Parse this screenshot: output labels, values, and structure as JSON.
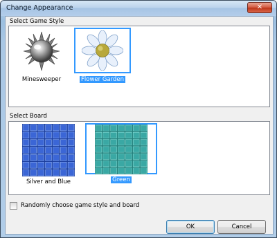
{
  "window": {
    "title": "Change Appearance",
    "close_symbol": "✕"
  },
  "game_style": {
    "label": "Select Game Style",
    "items": [
      {
        "name": "Minesweeper",
        "icon": "mine-icon",
        "selected": false
      },
      {
        "name": "Flower Garden",
        "icon": "flower-icon",
        "selected": true
      }
    ]
  },
  "board": {
    "label": "Select Board",
    "items": [
      {
        "name": "Silver and Blue",
        "icon": "blue-board-icon",
        "selected": false
      },
      {
        "name": "Green",
        "icon": "green-board-icon",
        "selected": true
      }
    ]
  },
  "random_option": {
    "label": "Randomly choose game style and board",
    "checked": false
  },
  "buttons": {
    "ok": "OK",
    "cancel": "Cancel"
  },
  "colors": {
    "selection": "#3399ff",
    "blue_tile": "#3b66d6",
    "green_tile": "#3aa8a4"
  }
}
